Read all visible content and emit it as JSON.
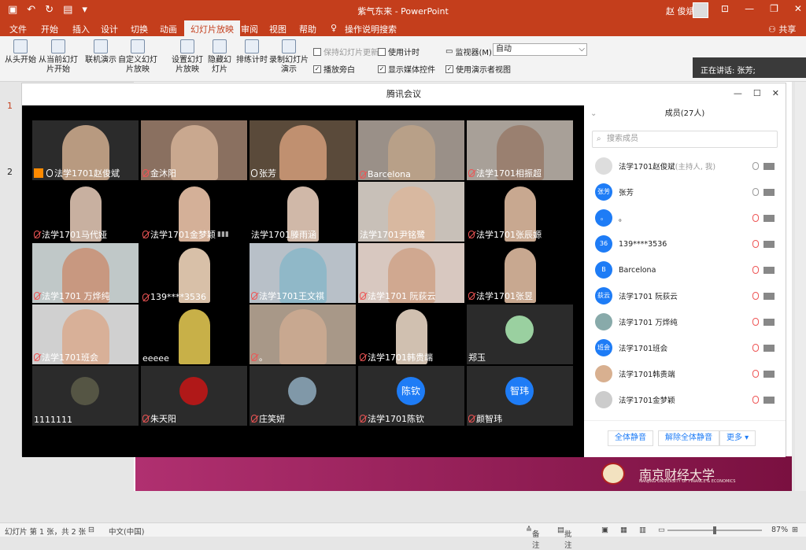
{
  "window": {
    "title": "紫气东来 - PowerPoint",
    "user": "赵 俊斌"
  },
  "menu": [
    "文件",
    "开始",
    "插入",
    "设计",
    "切换",
    "动画",
    "幻灯片放映",
    "审阅",
    "视图",
    "帮助",
    "操作说明搜索"
  ],
  "menu_share": "共享",
  "ribbon": {
    "btn_from_start": "从头开始",
    "btn_from_current": "从当前幻灯片开始",
    "btn_online": "联机演示",
    "btn_custom": "自定义幻灯片放映",
    "btn_setup": "设置幻灯片放映",
    "btn_hide": "隐藏幻灯片",
    "btn_rehearse": "排练计时",
    "btn_record": "录制幻灯片演示",
    "chk_keep_updated": "保持幻灯片更新",
    "chk_narration": "播放旁白",
    "chk_timing": "使用计时",
    "chk_media": "显示媒体控件",
    "monitor_label": "监视器(M):",
    "monitor_value": "自动",
    "chk_presenter": "使用演示者视图"
  },
  "speaking": "正在讲话: 张芳;",
  "slides": [
    "1",
    "2"
  ],
  "meeting": {
    "title": "腾讯会议",
    "members_header": "成员(27人)",
    "search_placeholder": "搜索成员",
    "tiles": [
      "法学1701赵俊斌",
      "金沐阳",
      "张芳",
      "Barcelona",
      "法学1701相振超",
      "法学1701马代娅",
      "法学1701金梦颖",
      "法学1701滕雨涵",
      "法学1701尹铭鹭",
      "法学1701张辰嫄",
      "法学1701 万烨纯",
      "139****3536",
      "法学1701王文祺",
      "法学1701 阮荻云",
      "法学1701张昱",
      "法学1701班会",
      "eeeee",
      "。",
      "法学1701韩贵端",
      "郑玉",
      "1111111",
      "朱天阳",
      "庄笑妍",
      "法学1701陈钦",
      "颜智玮"
    ],
    "tile_avatars": {
      "t23": "陈钦",
      "t24": "智玮"
    },
    "members": [
      {
        "name": "法学1701赵俊斌",
        "note": "(主持人, 我)",
        "avatar": ""
      },
      {
        "name": "张芳",
        "note": "",
        "avatar": "张芳"
      },
      {
        "name": "。",
        "note": "",
        "avatar": "。"
      },
      {
        "name": "139****3536",
        "note": "",
        "avatar": "36"
      },
      {
        "name": "Barcelona",
        "note": "",
        "avatar": "B"
      },
      {
        "name": "法学1701 阮荻云",
        "note": "",
        "avatar": "荻云"
      },
      {
        "name": "法学1701 万烨纯",
        "note": "",
        "avatar": ""
      },
      {
        "name": "法学1701班会",
        "note": "",
        "avatar": "班会"
      },
      {
        "name": "法学1701韩贵端",
        "note": "",
        "avatar": ""
      },
      {
        "name": "法学1701金梦颖",
        "note": "",
        "avatar": ""
      }
    ],
    "footer": {
      "mute_all": "全体静音",
      "unmute_all": "解除全体静音",
      "more": "更多 ▾"
    }
  },
  "banner": {
    "title": "南京财经大学",
    "subtitle": "NANJING UNIVERSITY OF FINANCE & ECONOMICS"
  },
  "status": {
    "slide_info": "幻灯片 第 1 张，共 2 张",
    "lang": "中文(中国)",
    "notes": "备注",
    "comments": "批注",
    "zoom": "87%"
  },
  "colors": {
    "accent": "#c43e1c",
    "tencent_blue": "#1e7cf6"
  }
}
